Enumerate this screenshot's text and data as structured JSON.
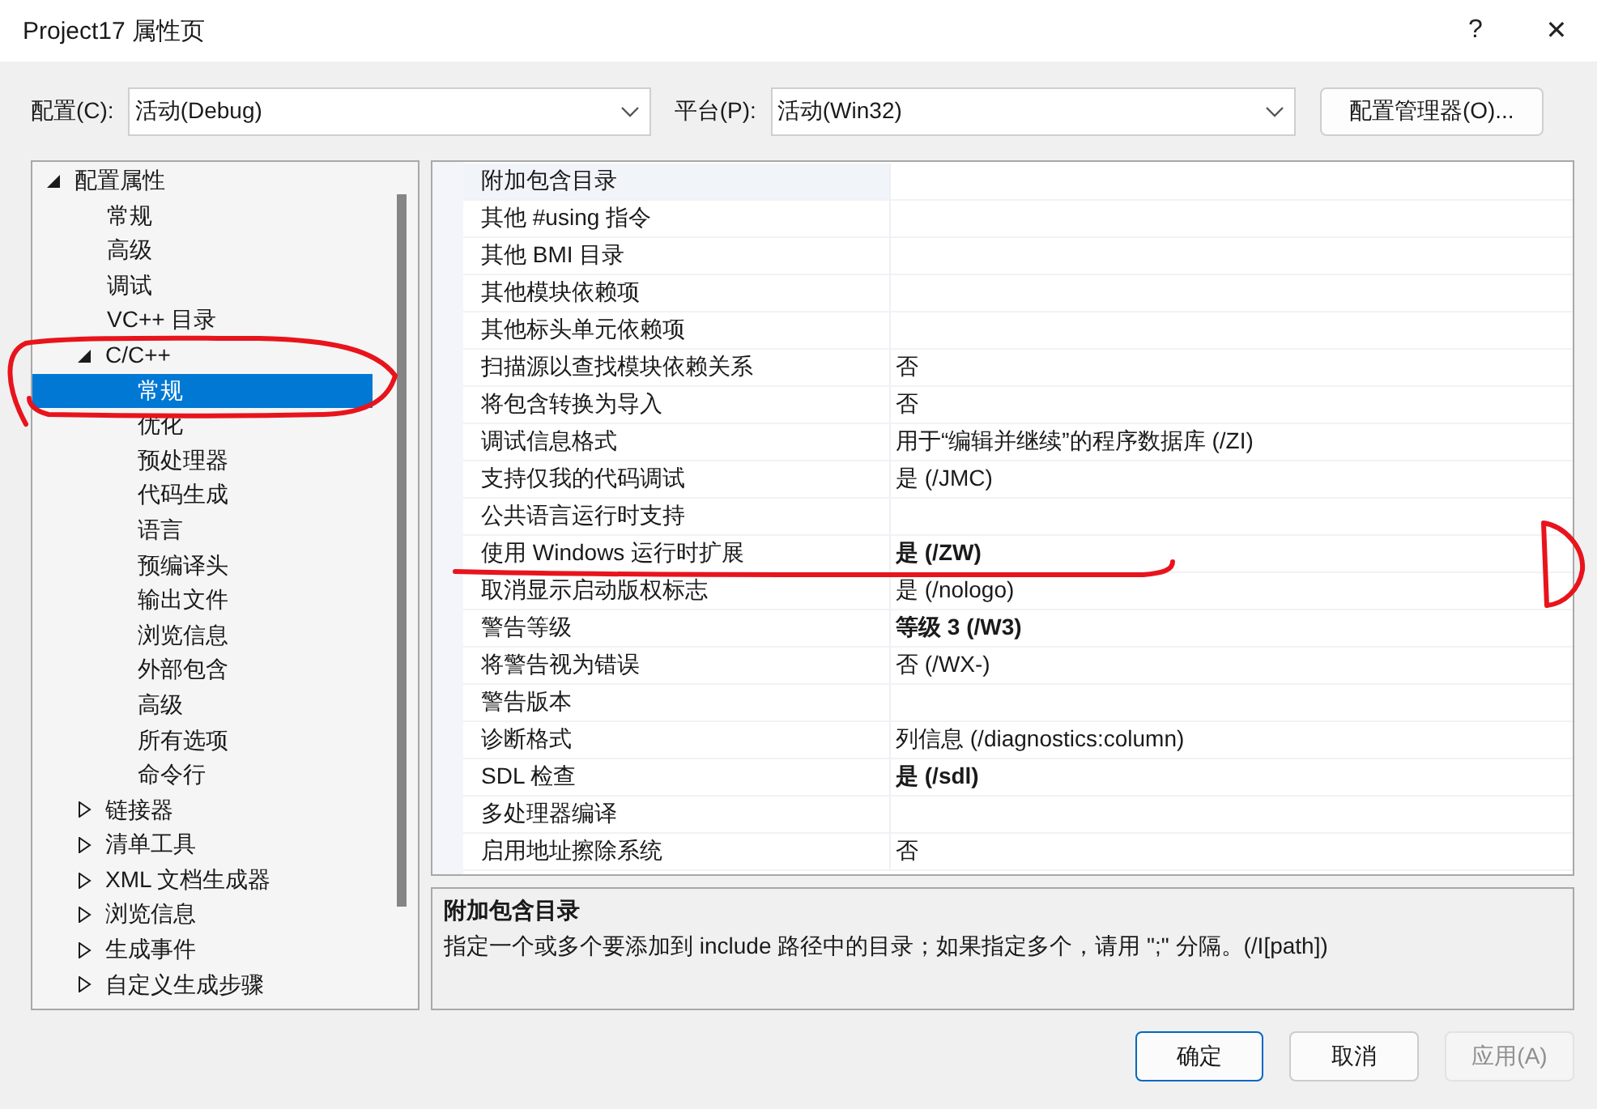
{
  "window": {
    "title": "Project17 属性页",
    "help_button": "?",
    "close_button": "✕"
  },
  "config_bar": {
    "config_label": "配置(C):",
    "config_value": "活动(Debug)",
    "platform_label": "平台(P):",
    "platform_value": "活动(Win32)",
    "manager_button": "配置管理器(O)..."
  },
  "tree": [
    {
      "label": "配置属性",
      "expanded": true,
      "selected": false,
      "children": [
        {
          "label": "常规",
          "selected": false
        },
        {
          "label": "高级",
          "selected": false
        },
        {
          "label": "调试",
          "selected": false
        },
        {
          "label": "VC++ 目录",
          "selected": false
        },
        {
          "label": "C/C++",
          "expanded": true,
          "selected": false,
          "children": [
            {
              "label": "常规",
              "selected": true
            },
            {
              "label": "优化",
              "selected": false
            },
            {
              "label": "预处理器",
              "selected": false
            },
            {
              "label": "代码生成",
              "selected": false
            },
            {
              "label": "语言",
              "selected": false
            },
            {
              "label": "预编译头",
              "selected": false
            },
            {
              "label": "输出文件",
              "selected": false
            },
            {
              "label": "浏览信息",
              "selected": false
            },
            {
              "label": "外部包含",
              "selected": false
            },
            {
              "label": "高级",
              "selected": false
            },
            {
              "label": "所有选项",
              "selected": false
            },
            {
              "label": "命令行",
              "selected": false
            }
          ]
        },
        {
          "label": "链接器",
          "expanded": false,
          "selected": false
        },
        {
          "label": "清单工具",
          "expanded": false,
          "selected": false
        },
        {
          "label": "XML 文档生成器",
          "expanded": false,
          "selected": false
        },
        {
          "label": "浏览信息",
          "expanded": false,
          "selected": false
        },
        {
          "label": "生成事件",
          "expanded": false,
          "selected": false
        },
        {
          "label": "自定义生成步骤",
          "expanded": false,
          "selected": false
        }
      ]
    }
  ],
  "properties": [
    {
      "name": "附加包含目录",
      "selected": true
    },
    {
      "name": "其他 #using 指令",
      "selected": false
    },
    {
      "name": "其他 BMI 目录",
      "selected": false
    },
    {
      "name": "其他模块依赖项",
      "selected": false
    },
    {
      "name": "其他标头单元依赖项",
      "selected": false
    },
    {
      "name": "扫描源以查找模块依赖关系",
      "value": "否",
      "bold": false,
      "selected": false
    },
    {
      "name": "将包含转换为导入",
      "value": "否",
      "bold": false,
      "selected": false
    },
    {
      "name": "调试信息格式",
      "value": "用于“编辑并继续”的程序数据库 (/ZI)",
      "bold": false,
      "selected": false
    },
    {
      "name": "支持仅我的代码调试",
      "value": "是 (/JMC)",
      "bold": false,
      "selected": false
    },
    {
      "name": "公共语言运行时支持",
      "selected": false
    },
    {
      "name": "使用 Windows 运行时扩展",
      "value": "是 (/ZW)",
      "bold": true,
      "selected": false
    },
    {
      "name": "取消显示启动版权标志",
      "value": "是 (/nologo)",
      "bold": false,
      "selected": false
    },
    {
      "name": "警告等级",
      "value": "等级 3 (/W3)",
      "bold": true,
      "selected": false
    },
    {
      "name": "将警告视为错误",
      "value": "否 (/WX-)",
      "bold": false,
      "selected": false
    },
    {
      "name": "警告版本",
      "selected": false
    },
    {
      "name": "诊断格式",
      "value": "列信息 (/diagnostics:column)",
      "bold": false,
      "selected": false
    },
    {
      "name": "SDL 检查",
      "value": "是 (/sdl)",
      "bold": true,
      "selected": false
    },
    {
      "name": "多处理器编译",
      "selected": false
    },
    {
      "name": "启用地址擦除系统",
      "value": "否",
      "bold": false,
      "selected": false
    }
  ],
  "description": {
    "title": "附加包含目录",
    "text": "指定一个或多个要添加到 include 路径中的目录；如果指定多个，请用 \";\" 分隔。(/I[path])"
  },
  "buttons": [
    {
      "label": "确定",
      "kind": "default",
      "disabled": false
    },
    {
      "label": "取消",
      "kind": "normal",
      "disabled": false
    },
    {
      "label": "应用(A)",
      "kind": "normal",
      "disabled": true
    }
  ]
}
